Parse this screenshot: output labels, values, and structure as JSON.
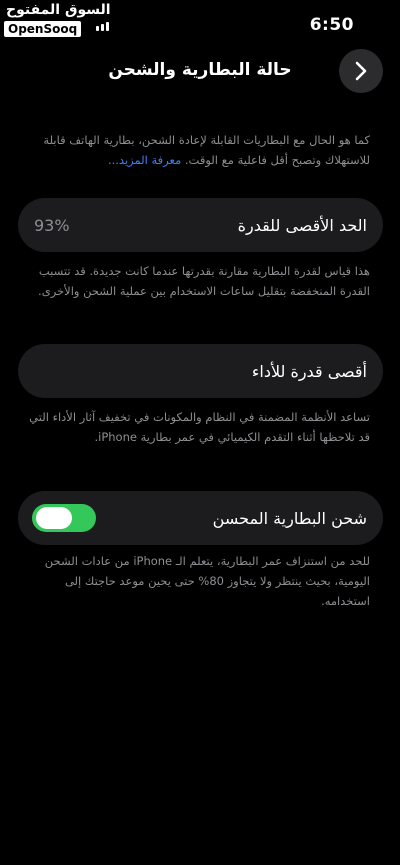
{
  "status_bar": {
    "time": "6:50",
    "watermark_arabic": "السوق المفتوح",
    "watermark_brand": "OpenSooq"
  },
  "nav": {
    "title": "حالة البطارية والشحن",
    "back_icon": "chevron-right-icon"
  },
  "intro": {
    "text": "كما هو الحال مع البطاريات القابلة لإعادة الشحن، بطارية الهاتف قابلة للاستهلاك وتصبح أقل فاعلية مع الوقت.",
    "link": "معرفة المزيد..."
  },
  "maximum_capacity": {
    "label": "الحد الأقصى للقدرة",
    "value": "93%",
    "description": "هذا قياس لقدرة البطارية مقارنة بقدرتها عندما كانت جديدة. قد تتسبب القدرة المنخفضة بتقليل ساعات الاستخدام بين عملية الشحن والأخرى."
  },
  "peak_performance": {
    "label": "أقصى قدرة للأداء",
    "description": "تساعد الأنظمة المضمنة في النظام والمكونات في تخفيف آثار الأداء التي قد تلاحظها أثناء التقدم الكيميائي في عمر بطارية iPhone."
  },
  "optimized_charging": {
    "label": "شحن البطارية المحسن",
    "enabled": true,
    "toggle_color": "#34c759",
    "description": "للحد من استنزاف عمر البطارية، يتعلم الـ iPhone من عادات الشحن اليومية، بحيث ينتظر ولا يتجاوز 80% حتى يحين موعد حاجتك إلى استخدامه."
  }
}
